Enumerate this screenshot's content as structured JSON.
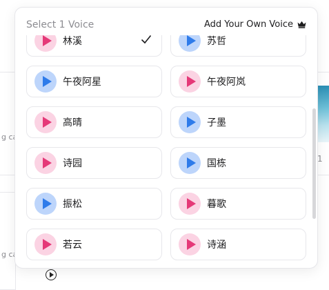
{
  "background": {
    "frag_text_1": "g ca",
    "frag_text_2": "g ca",
    "frag_text_3": "1"
  },
  "popup": {
    "title": "Select 1 Voice",
    "add_voice_label": "Add Your Own Voice",
    "add_voice_icon": "crown-icon",
    "colors": {
      "pink_avatar": "#fbd3e3",
      "pink_play": "#e53978",
      "blue_avatar": "#bdd5fb",
      "blue_play": "#2e7bea"
    },
    "voices": [
      {
        "name": "林溪",
        "color": "pink",
        "selected": true
      },
      {
        "name": "苏哲",
        "color": "blue",
        "selected": false
      },
      {
        "name": "午夜阿星",
        "color": "blue",
        "selected": false
      },
      {
        "name": "午夜阿岚",
        "color": "pink",
        "selected": false
      },
      {
        "name": "高晴",
        "color": "pink",
        "selected": false
      },
      {
        "name": "子墨",
        "color": "blue",
        "selected": false
      },
      {
        "name": "诗园",
        "color": "pink",
        "selected": false
      },
      {
        "name": "国栋",
        "color": "blue",
        "selected": false
      },
      {
        "name": "振松",
        "color": "blue",
        "selected": false
      },
      {
        "name": "暮歌",
        "color": "pink",
        "selected": false
      },
      {
        "name": "若云",
        "color": "pink",
        "selected": false
      },
      {
        "name": "诗涵",
        "color": "pink",
        "selected": false
      }
    ]
  }
}
